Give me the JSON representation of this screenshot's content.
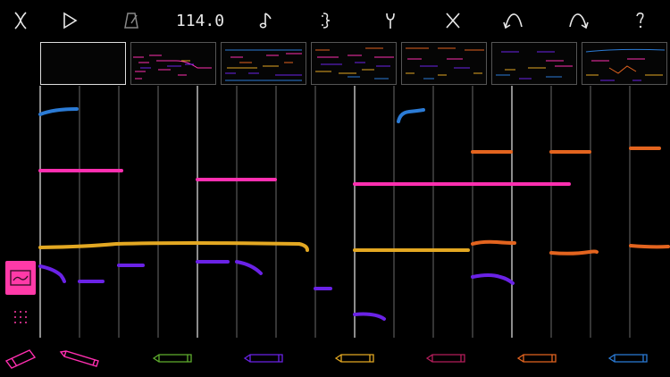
{
  "toolbar": {
    "tempo": "114.0",
    "icons": [
      "clear-icon",
      "play-icon",
      "metronome-icon",
      "tempo",
      "note-icon",
      "brace-icon",
      "wrench-icon",
      "close-icon",
      "undo-icon",
      "redo-icon",
      "help-icon"
    ]
  },
  "thumbnails": {
    "count": 7,
    "selected_index": 0
  },
  "colors": {
    "blue": "#2b7bd6",
    "pink": "#ff2fb0",
    "yellow": "#e3a822",
    "purple": "#6a22e6",
    "orange": "#e3641f",
    "green": "#5fae2e",
    "crimson": "#b31d5a",
    "sidebar_accent": "#ff3aa8",
    "gridline": "#6a6a6a"
  },
  "tools": {
    "items": [
      {
        "name": "eraser-tool",
        "color": "#ff2fb0"
      },
      {
        "name": "pencil-pink",
        "color": "#ff2fb0"
      },
      {
        "name": "pencil-green",
        "color": "#5fae2e"
      },
      {
        "name": "pencil-purple",
        "color": "#6a22e6"
      },
      {
        "name": "pencil-yellow",
        "color": "#e3a822"
      },
      {
        "name": "pencil-crimson",
        "color": "#b31d5a"
      },
      {
        "name": "pencil-orange",
        "color": "#e3641f"
      },
      {
        "name": "pencil-blue",
        "color": "#2b7bd6"
      }
    ]
  }
}
